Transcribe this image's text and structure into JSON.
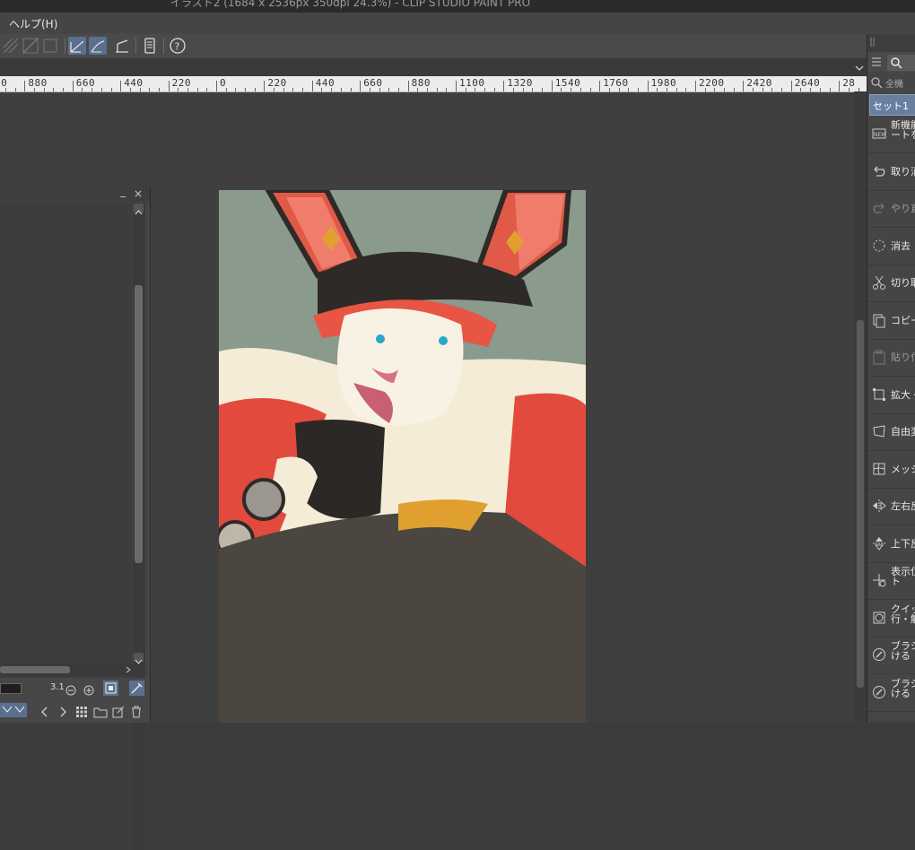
{
  "window": {
    "title": "イラスト2 (1684 x 2536px 350dpi 24.3%)  - CLIP STUDIO PAINT PRO"
  },
  "menu": {
    "help": "ヘルプ(H)"
  },
  "ruler": {
    "labels": [
      "00",
      "880",
      "660",
      "440",
      "220",
      "0",
      "220",
      "440",
      "660",
      "880",
      "1100",
      "1320",
      "1540",
      "1760",
      "1980",
      "2200",
      "2420",
      "2640",
      "28"
    ]
  },
  "left_panel": {
    "zoom_value": "3.1",
    "minimize_label": "_",
    "close_label": "×"
  },
  "right_panel": {
    "search_hint": "全機",
    "set_label": "セット1",
    "commands": [
      {
        "label": "新機能",
        "label2": "ートを",
        "icon": "new-feature-icon",
        "enabled": true
      },
      {
        "label": "取り消",
        "icon": "undo-icon",
        "enabled": true
      },
      {
        "label": "やり直",
        "icon": "redo-icon",
        "enabled": false
      },
      {
        "label": "消去",
        "icon": "clear-icon",
        "enabled": true
      },
      {
        "label": "切り取",
        "icon": "scissors-icon",
        "enabled": true
      },
      {
        "label": "コピー",
        "icon": "copy-icon",
        "enabled": true
      },
      {
        "label": "貼り付",
        "icon": "paste-icon",
        "enabled": false
      },
      {
        "label": "拡大・",
        "icon": "scale-icon",
        "enabled": true
      },
      {
        "label": "自由変",
        "icon": "free-transform-icon",
        "enabled": true
      },
      {
        "label": "メッシュ",
        "icon": "mesh-icon",
        "enabled": true
      },
      {
        "label": "左右反",
        "icon": "flip-horizontal-icon",
        "enabled": true
      },
      {
        "label": "上下反",
        "icon": "flip-vertical-icon",
        "enabled": true
      },
      {
        "label": "表示位",
        "label2": "ト",
        "icon": "view-position-icon",
        "enabled": true
      },
      {
        "label": "クイック",
        "label2": "行・解",
        "icon": "quick-mask-icon",
        "enabled": true
      },
      {
        "label": "ブラシ",
        "label2": "ける",
        "icon": "brush-apply-icon",
        "enabled": true
      },
      {
        "label": "ブラシ",
        "label2": "ける",
        "icon": "brush-apply-2-icon",
        "enabled": true
      }
    ]
  },
  "colors": {
    "accent": "#5b6f8e",
    "canvas_bg": "#3f3f3f",
    "art_bg": "#8a9a8c"
  }
}
